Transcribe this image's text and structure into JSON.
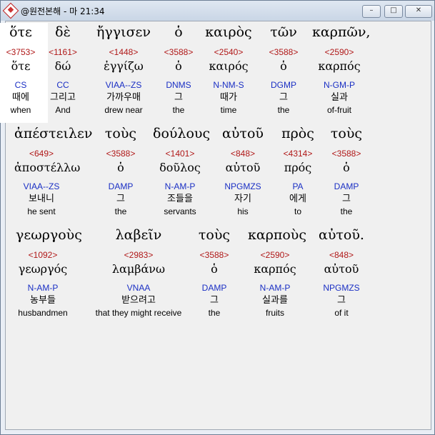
{
  "window": {
    "title": "@원전본해 - 마 21:34",
    "buttons": [
      "–",
      "□",
      "✕"
    ]
  },
  "rows": [
    [
      {
        "greek": "ὅτε",
        "num": "<3753>",
        "lemma": "ὅτε",
        "parse": "CS",
        "kor": "때에",
        "eng": "when"
      },
      {
        "greek": "δὲ",
        "num": "<1161>",
        "lemma": "δώ",
        "parse": "CC",
        "kor": "그리고",
        "eng": "And"
      },
      {
        "greek": "ἤγγισεν",
        "num": "<1448>",
        "lemma": "ἐγγίζω",
        "parse": "VIAA--ZS",
        "kor": "가까우매",
        "eng": "drew near"
      },
      {
        "greek": "ὁ",
        "num": "<3588>",
        "lemma": "ὁ",
        "parse": "DNMS",
        "kor": "그",
        "eng": "the"
      },
      {
        "greek": "καιρὸς",
        "num": "<2540>",
        "lemma": "καιρός",
        "parse": "N-NM-S",
        "kor": "때가",
        "eng": "time"
      },
      {
        "greek": "τῶν",
        "num": "<3588>",
        "lemma": "ὁ",
        "parse": "DGMP",
        "kor": "그",
        "eng": "the"
      },
      {
        "greek": "καρπῶν,",
        "num": "<2590>",
        "lemma": "καρπός",
        "parse": "N-GM-P",
        "kor": "실과",
        "eng": "of-fruit"
      }
    ],
    [
      {
        "greek": "ἀπέστειλεν",
        "num": "<649>",
        "lemma": "ἀποστέλλω",
        "parse": "VIAA--ZS",
        "kor": "보내니",
        "eng": "he sent"
      },
      {
        "greek": "τοὺς",
        "num": "<3588>",
        "lemma": "ὁ",
        "parse": "DAMP",
        "kor": "그",
        "eng": "the"
      },
      {
        "greek": "δούλους",
        "num": "<1401>",
        "lemma": "δοῦλος",
        "parse": "N-AM-P",
        "kor": "조들을",
        "eng": "servants"
      },
      {
        "greek": "αὐτοῦ",
        "num": "<848>",
        "lemma": "αὐτοῦ",
        "parse": "NPGMZS",
        "kor": "자기",
        "eng": "his"
      },
      {
        "greek": "πρὸς",
        "num": "<4314>",
        "lemma": "πρός",
        "parse": "PA",
        "kor": "에게",
        "eng": "to"
      },
      {
        "greek": "τοὺς",
        "num": "<3588>",
        "lemma": "ὁ",
        "parse": "DAMP",
        "kor": "그",
        "eng": "the"
      }
    ],
    [
      {
        "greek": "γεωργοὺς",
        "num": "<1092>",
        "lemma": "γεωργός",
        "parse": "N-AM-P",
        "kor": "농부들",
        "eng": "husbandmen"
      },
      {
        "greek": "λαβεῖν",
        "num": "<2983>",
        "lemma": "λαμβάνω",
        "parse": "VNAA",
        "kor": "받으려고",
        "eng": "that they might receive"
      },
      {
        "greek": "τοὺς",
        "num": "<3588>",
        "lemma": "ὁ",
        "parse": "DAMP",
        "kor": "그",
        "eng": "the"
      },
      {
        "greek": "καρποὺς",
        "num": "<2590>",
        "lemma": "καρπός",
        "parse": "N-AM-P",
        "kor": "실과를",
        "eng": "fruits"
      },
      {
        "greek": "αὐτοῦ.",
        "num": "<848>",
        "lemma": "αὐτοῦ",
        "parse": "NPGMZS",
        "kor": "그",
        "eng": "of it"
      }
    ]
  ]
}
